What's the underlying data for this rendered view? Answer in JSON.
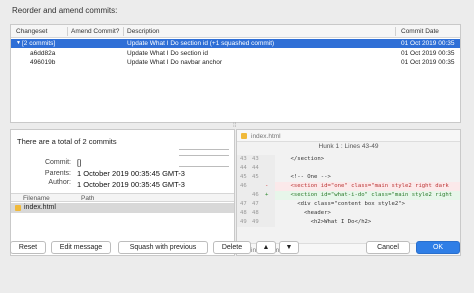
{
  "heading": "Reorder and amend commits:",
  "table": {
    "columns": [
      "Changeset",
      "Amend Commit?",
      "Description",
      "Commit Date"
    ],
    "rows": [
      {
        "changeset": "[2 commits]",
        "amend": "",
        "description": "Update What I Do section id (+1 squashed commit)",
        "date": "01 Oct 2019 00:35",
        "selected": true,
        "group": true
      },
      {
        "changeset": "a6dd82a",
        "amend": "",
        "description": "Update What I Do section id",
        "date": "01 Oct 2019 00:35",
        "selected": false,
        "group": false
      },
      {
        "changeset": "496019b",
        "amend": "",
        "description": "Update What I Do navbar anchor",
        "date": "01 Oct 2019 00:35",
        "selected": false,
        "group": false
      }
    ]
  },
  "details": {
    "total": "There are a total of 2 commits",
    "commit_label": "Commit:",
    "commit_value": "[]",
    "parents_label": "Parents:",
    "parents_value": "1 October 2019 00:35:45 GMT-3",
    "author_label": "Author:",
    "author_value": "1 October 2019 00:35:45 GMT-3",
    "file_columns": [
      "Filename",
      "Path"
    ],
    "files": [
      {
        "name": "index.html",
        "path": ""
      }
    ]
  },
  "diff": {
    "file_name": "index.html",
    "hunk": "Hunk 1 : Lines 43-49",
    "lines": [
      {
        "old": "43",
        "new": "43",
        "sign": "",
        "type": "ctx",
        "text": "    </section>"
      },
      {
        "old": "44",
        "new": "44",
        "sign": "",
        "type": "ctx",
        "text": ""
      },
      {
        "old": "45",
        "new": "45",
        "sign": "",
        "type": "ctx",
        "text": "    <!-- One -->"
      },
      {
        "old": "46",
        "new": "",
        "sign": "-",
        "type": "del",
        "text": "    <section id=\"one\" class=\"main style2 right dark"
      },
      {
        "old": "",
        "new": "46",
        "sign": "+",
        "type": "add",
        "text": "    <section id=\"what-i-do\" class=\"main style2 right"
      },
      {
        "old": "47",
        "new": "47",
        "sign": "",
        "type": "ctx",
        "text": "      <div class=\"content box style2\">"
      },
      {
        "old": "48",
        "new": "48",
        "sign": "",
        "type": "ctx",
        "text": "        <header>"
      },
      {
        "old": "49",
        "new": "49",
        "sign": "",
        "type": "ctx",
        "text": "          <h2>What I Do</h2>"
      }
    ],
    "footer_file": "index.html"
  },
  "buttons": {
    "reset": "Reset",
    "edit_message": "Edit message",
    "squash": "Squash with previous",
    "delete": "Delete",
    "up": "▲",
    "down": "▼",
    "cancel": "Cancel",
    "ok": "OK"
  },
  "colors": {
    "selection": "#2f6fd6",
    "primary": "#2f7ee6",
    "file_icon": "#f0b93a"
  }
}
